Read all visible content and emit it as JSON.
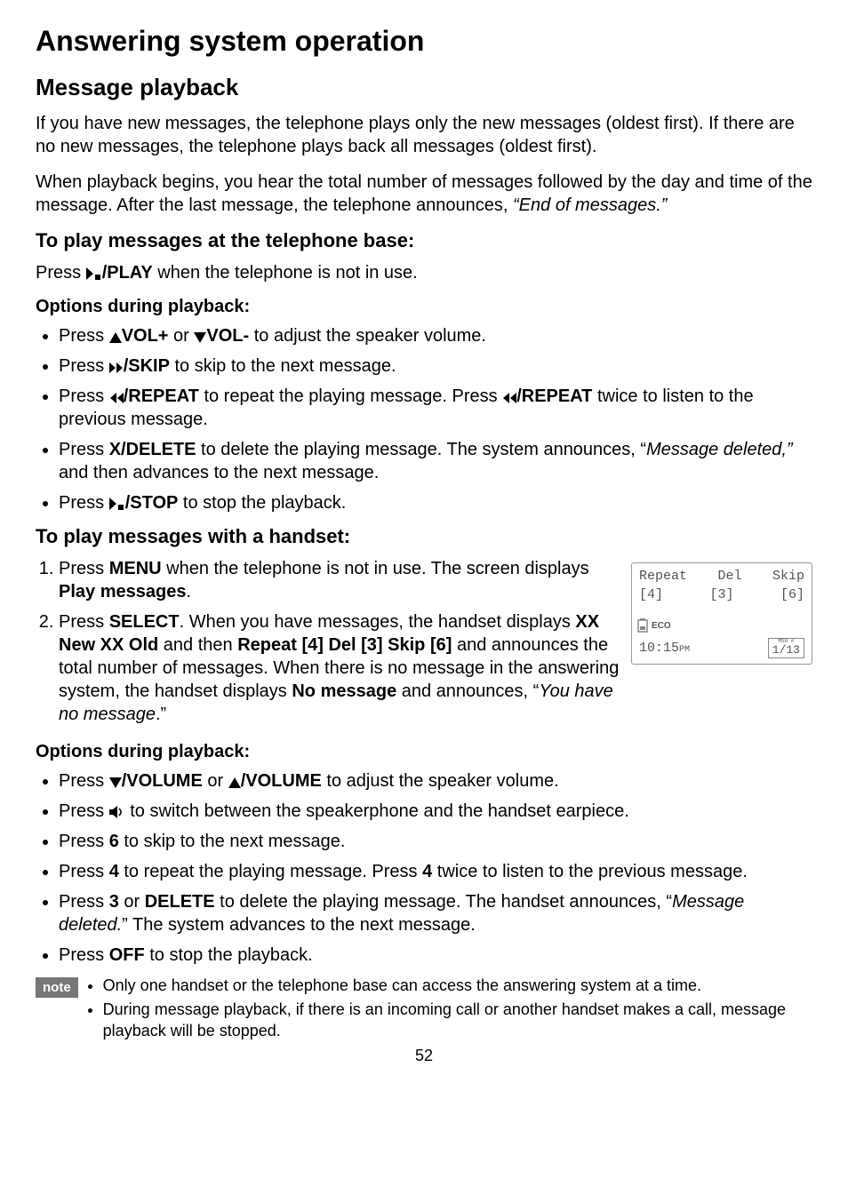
{
  "title": "Answering system operation",
  "section": "Message playback",
  "intro_p1": "If you have new messages, the telephone plays only the new messages (oldest first). If there are no new messages, the telephone plays back all messages (oldest first).",
  "intro_p2_a": "When playback begins, you hear the total number of messages followed by the day and time of the message. After the last message, the telephone announces, ",
  "intro_p2_italic": "“End of messages.”",
  "base": {
    "heading": "To play messages at the telephone base:",
    "line_a": "Press ",
    "line_key": "/PLAY",
    "line_b": " when the telephone is not in use.",
    "options_heading": "Options during playback:",
    "b1_a": "Press ",
    "b1_key1": "VOL+",
    "b1_mid": " or ",
    "b1_key2": "VOL-",
    "b1_b": " to adjust the speaker volume.",
    "b2_a": "Press ",
    "b2_key": "/SKIP",
    "b2_b": " to skip to the next message.",
    "b3_a": "Press ",
    "b3_key1": "/REPEAT",
    "b3_mid": " to repeat the playing message. Press ",
    "b3_key2": "/REPEAT",
    "b3_b": " twice to listen to the previous message.",
    "b4_a": "Press ",
    "b4_key": "X/DELETE",
    "b4_mid": " to delete the playing message. The system announces, “",
    "b4_italic": "Message deleted,” ",
    "b4_b": "and then advances to the next message.",
    "b5_a": "Press ",
    "b5_key": "/STOP",
    "b5_b": " to stop the playback."
  },
  "handset": {
    "heading": "To play messages with a handset:",
    "s1_a": "Press ",
    "s1_key": "MENU",
    "s1_b": " when the telephone is not in use. The screen displays ",
    "s1_bold": "Play messages",
    "s1_c": ".",
    "s2_a": "Press ",
    "s2_key": "SELECT",
    "s2_b": ". When you have messages, the handset displays ",
    "s2_bold1": "XX New XX Old",
    "s2_mid1": " and then ",
    "s2_bold2": "Repeat [4] Del [3] Skip [6]",
    "s2_mid2": " and announces the total number of messages. When there is no message in the answering system, the handset displays ",
    "s2_bold3": "No message",
    "s2_mid3": " and announces, “",
    "s2_italic": "You have no message",
    "s2_c": ".”",
    "options_heading": "Options during playback:",
    "b1_a": "Press ",
    "b1_key1": "/VOLUME",
    "b1_mid": " or ",
    "b1_key2": "/VOLUME",
    "b1_b": " to adjust the speaker volume.",
    "b2_a": "Press ",
    "b2_b": " to switch between the speakerphone and the handset earpiece.",
    "b3_a": "Press ",
    "b3_key": "6",
    "b3_b": " to skip to the next message.",
    "b4_a": "Press ",
    "b4_key1": "4",
    "b4_mid": " to repeat the playing message. Press ",
    "b4_key2": "4",
    "b4_b": " twice to listen to the previous message.",
    "b5_a": "Press ",
    "b5_key1": "3",
    "b5_mid1": " or ",
    "b5_key2": "DELETE",
    "b5_mid2": " to delete the playing message. The handset announces, “",
    "b5_italic": "Message deleted.",
    "b5_b": "” The system advances to the next message.",
    "b6_a": "Press ",
    "b6_key": "OFF",
    "b6_b": " to stop the playback."
  },
  "screen": {
    "r1c1": "Repeat",
    "r1c2": "Del",
    "r1c3": "Skip",
    "r2c1": "[4]",
    "r2c2": "[3]",
    "r2c3": "[6]",
    "eco": "ECO",
    "time": "10:15",
    "ampm": "PM",
    "msg_label": "MSG #",
    "msg_count": "1/13"
  },
  "note": {
    "badge": "note",
    "n1": "Only one handset or the telephone base can access the answering system at a time.",
    "n2": "During message playback, if there is an incoming call or another handset makes a call, message playback will be stopped."
  },
  "page_number": "52"
}
